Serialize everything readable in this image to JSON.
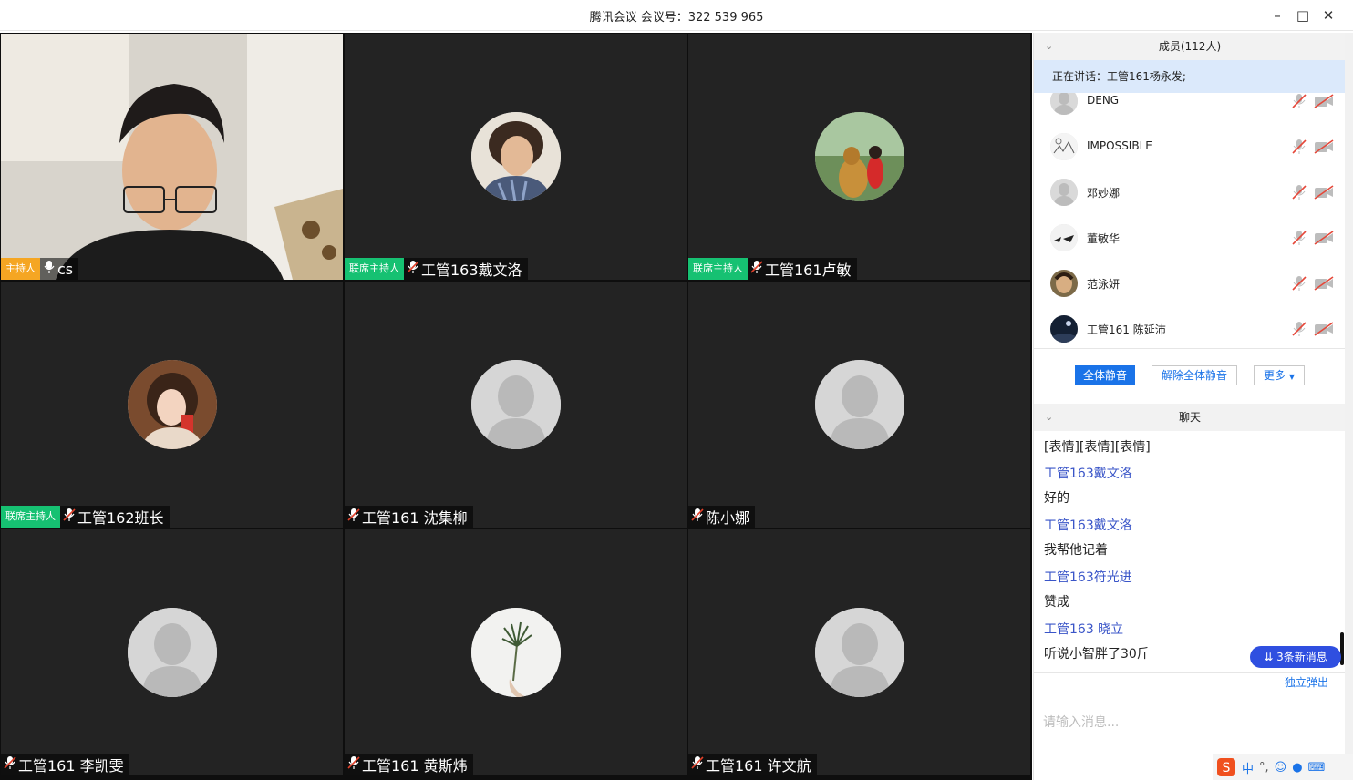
{
  "window": {
    "title": "腾讯会议 会议号：322 539 965",
    "controls": [
      "minimize",
      "maximize",
      "close"
    ]
  },
  "tiles": [
    {
      "badge": "主持人",
      "badge_type": "host",
      "name": "cs",
      "video": "camera-feed"
    },
    {
      "badge": "联席主持人",
      "badge_type": "cohost",
      "name": "工管163戴文洛",
      "avatar": "photo-man-curly-hair"
    },
    {
      "badge": "联席主持人",
      "badge_type": "cohost",
      "name": "工管161卢敏",
      "avatar": "photo-dog-and-child"
    },
    {
      "badge": "联席主持人",
      "badge_type": "cohost",
      "name": "工管162班长",
      "avatar": "photo-girl"
    },
    {
      "badge": "",
      "badge_type": "",
      "name": "工管161 沈集柳",
      "avatar": "default"
    },
    {
      "badge": "",
      "badge_type": "",
      "name": "陈小娜",
      "avatar": "default"
    },
    {
      "badge": "",
      "badge_type": "",
      "name": "工管161 李凯雯",
      "avatar": "default"
    },
    {
      "badge": "",
      "badge_type": "",
      "name": "工管161 黄斯炜",
      "avatar": "photo-plant"
    },
    {
      "badge": "",
      "badge_type": "",
      "name": "工管161 许文航",
      "avatar": "default"
    }
  ],
  "members": {
    "header": "成员(112人)",
    "speaking": "正在讲话：工管161杨永发;",
    "list": [
      {
        "name": "DENG",
        "avatar": "default"
      },
      {
        "name": "IMPOSSIBLE",
        "avatar": "sketch"
      },
      {
        "name": "邓妙娜",
        "avatar": "default"
      },
      {
        "name": "董敏华",
        "avatar": "sketch-dark"
      },
      {
        "name": "范泳妍",
        "avatar": "photo-face"
      },
      {
        "name": "工管161 陈延沛",
        "avatar": "photo-night"
      }
    ],
    "mute_all": "全体静音",
    "unmute_all": "解除全体静音",
    "more": "更多"
  },
  "chat": {
    "header": "聊天",
    "messages": [
      {
        "type": "text",
        "value": "[表情][表情][表情]"
      },
      {
        "type": "sender",
        "value": "工管163戴文洛"
      },
      {
        "type": "text",
        "value": "好的"
      },
      {
        "type": "sender",
        "value": "工管163戴文洛"
      },
      {
        "type": "text",
        "value": "我帮他记着"
      },
      {
        "type": "sender",
        "value": "工管163符光进"
      },
      {
        "type": "text",
        "value": "赞成"
      },
      {
        "type": "sender",
        "value": "工管163 晓立"
      },
      {
        "type": "text",
        "value": "听说小智胖了30斤"
      }
    ],
    "new_messages": "3条新消息",
    "popout": "独立弹出",
    "input_placeholder": "请输入消息..."
  },
  "ime": {
    "label": "中"
  },
  "colors": {
    "host": "#f5a623",
    "cohost": "#16c172",
    "accent": "#1a73e8",
    "tile_bg": "#232323"
  }
}
